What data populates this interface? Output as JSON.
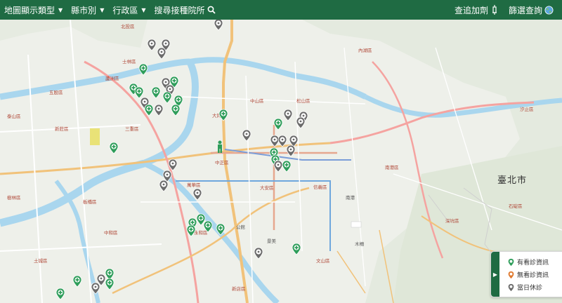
{
  "toolbar": {
    "map_type": "地圖顯示類型",
    "city": "縣市別",
    "district": "行政區",
    "search": "搜尋接種院所",
    "booster_search": "查追加劑",
    "filter_search": "篩選查詢"
  },
  "map": {
    "city_label": "臺北市",
    "labels": [
      "北投區",
      "士林區",
      "內湖區",
      "中山區",
      "松山區",
      "大同區",
      "南港區",
      "信義區",
      "大安區",
      "中正區",
      "萬華區",
      "三重區",
      "蘆洲區",
      "五股區",
      "新莊區",
      "泰山區",
      "板橋區",
      "中和區",
      "永和區",
      "文山區",
      "汐止區",
      "木柵",
      "南港",
      "深坑區",
      "石碇區",
      "新店區",
      "景美",
      "公館",
      "土城區",
      "樹林區"
    ]
  },
  "legend": {
    "items": [
      {
        "label": "有看診資訊",
        "color": "#2e9d5a"
      },
      {
        "label": "無看診資訊",
        "color": "#e07a30"
      },
      {
        "label": "當日休診",
        "color": "#6b6b6b"
      }
    ]
  },
  "colors": {
    "header": "#1f6b43",
    "pin_open": "#2e9d5a",
    "pin_closed": "#6b6b6b",
    "river": "#a9d6ee"
  }
}
